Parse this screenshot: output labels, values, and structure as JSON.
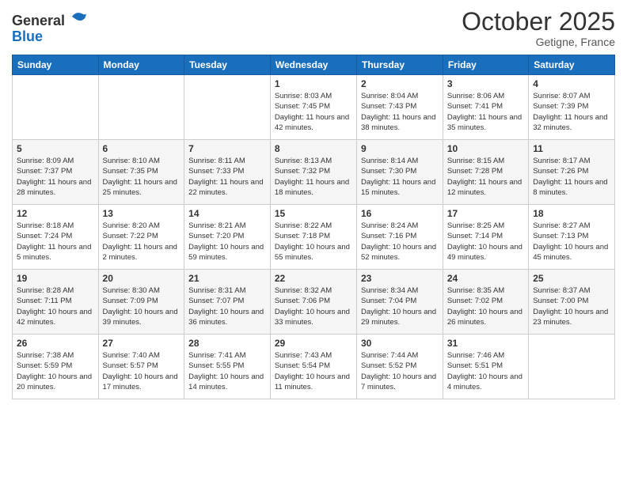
{
  "logo": {
    "line1": "General",
    "line2": "Blue"
  },
  "header": {
    "month": "October 2025",
    "location": "Getigne, France"
  },
  "weekdays": [
    "Sunday",
    "Monday",
    "Tuesday",
    "Wednesday",
    "Thursday",
    "Friday",
    "Saturday"
  ],
  "weeks": [
    [
      {
        "day": "",
        "sunrise": "",
        "sunset": "",
        "daylight": ""
      },
      {
        "day": "",
        "sunrise": "",
        "sunset": "",
        "daylight": ""
      },
      {
        "day": "",
        "sunrise": "",
        "sunset": "",
        "daylight": ""
      },
      {
        "day": "1",
        "sunrise": "Sunrise: 8:03 AM",
        "sunset": "Sunset: 7:45 PM",
        "daylight": "Daylight: 11 hours and 42 minutes."
      },
      {
        "day": "2",
        "sunrise": "Sunrise: 8:04 AM",
        "sunset": "Sunset: 7:43 PM",
        "daylight": "Daylight: 11 hours and 38 minutes."
      },
      {
        "day": "3",
        "sunrise": "Sunrise: 8:06 AM",
        "sunset": "Sunset: 7:41 PM",
        "daylight": "Daylight: 11 hours and 35 minutes."
      },
      {
        "day": "4",
        "sunrise": "Sunrise: 8:07 AM",
        "sunset": "Sunset: 7:39 PM",
        "daylight": "Daylight: 11 hours and 32 minutes."
      }
    ],
    [
      {
        "day": "5",
        "sunrise": "Sunrise: 8:09 AM",
        "sunset": "Sunset: 7:37 PM",
        "daylight": "Daylight: 11 hours and 28 minutes."
      },
      {
        "day": "6",
        "sunrise": "Sunrise: 8:10 AM",
        "sunset": "Sunset: 7:35 PM",
        "daylight": "Daylight: 11 hours and 25 minutes."
      },
      {
        "day": "7",
        "sunrise": "Sunrise: 8:11 AM",
        "sunset": "Sunset: 7:33 PM",
        "daylight": "Daylight: 11 hours and 22 minutes."
      },
      {
        "day": "8",
        "sunrise": "Sunrise: 8:13 AM",
        "sunset": "Sunset: 7:32 PM",
        "daylight": "Daylight: 11 hours and 18 minutes."
      },
      {
        "day": "9",
        "sunrise": "Sunrise: 8:14 AM",
        "sunset": "Sunset: 7:30 PM",
        "daylight": "Daylight: 11 hours and 15 minutes."
      },
      {
        "day": "10",
        "sunrise": "Sunrise: 8:15 AM",
        "sunset": "Sunset: 7:28 PM",
        "daylight": "Daylight: 11 hours and 12 minutes."
      },
      {
        "day": "11",
        "sunrise": "Sunrise: 8:17 AM",
        "sunset": "Sunset: 7:26 PM",
        "daylight": "Daylight: 11 hours and 8 minutes."
      }
    ],
    [
      {
        "day": "12",
        "sunrise": "Sunrise: 8:18 AM",
        "sunset": "Sunset: 7:24 PM",
        "daylight": "Daylight: 11 hours and 5 minutes."
      },
      {
        "day": "13",
        "sunrise": "Sunrise: 8:20 AM",
        "sunset": "Sunset: 7:22 PM",
        "daylight": "Daylight: 11 hours and 2 minutes."
      },
      {
        "day": "14",
        "sunrise": "Sunrise: 8:21 AM",
        "sunset": "Sunset: 7:20 PM",
        "daylight": "Daylight: 10 hours and 59 minutes."
      },
      {
        "day": "15",
        "sunrise": "Sunrise: 8:22 AM",
        "sunset": "Sunset: 7:18 PM",
        "daylight": "Daylight: 10 hours and 55 minutes."
      },
      {
        "day": "16",
        "sunrise": "Sunrise: 8:24 AM",
        "sunset": "Sunset: 7:16 PM",
        "daylight": "Daylight: 10 hours and 52 minutes."
      },
      {
        "day": "17",
        "sunrise": "Sunrise: 8:25 AM",
        "sunset": "Sunset: 7:14 PM",
        "daylight": "Daylight: 10 hours and 49 minutes."
      },
      {
        "day": "18",
        "sunrise": "Sunrise: 8:27 AM",
        "sunset": "Sunset: 7:13 PM",
        "daylight": "Daylight: 10 hours and 45 minutes."
      }
    ],
    [
      {
        "day": "19",
        "sunrise": "Sunrise: 8:28 AM",
        "sunset": "Sunset: 7:11 PM",
        "daylight": "Daylight: 10 hours and 42 minutes."
      },
      {
        "day": "20",
        "sunrise": "Sunrise: 8:30 AM",
        "sunset": "Sunset: 7:09 PM",
        "daylight": "Daylight: 10 hours and 39 minutes."
      },
      {
        "day": "21",
        "sunrise": "Sunrise: 8:31 AM",
        "sunset": "Sunset: 7:07 PM",
        "daylight": "Daylight: 10 hours and 36 minutes."
      },
      {
        "day": "22",
        "sunrise": "Sunrise: 8:32 AM",
        "sunset": "Sunset: 7:06 PM",
        "daylight": "Daylight: 10 hours and 33 minutes."
      },
      {
        "day": "23",
        "sunrise": "Sunrise: 8:34 AM",
        "sunset": "Sunset: 7:04 PM",
        "daylight": "Daylight: 10 hours and 29 minutes."
      },
      {
        "day": "24",
        "sunrise": "Sunrise: 8:35 AM",
        "sunset": "Sunset: 7:02 PM",
        "daylight": "Daylight: 10 hours and 26 minutes."
      },
      {
        "day": "25",
        "sunrise": "Sunrise: 8:37 AM",
        "sunset": "Sunset: 7:00 PM",
        "daylight": "Daylight: 10 hours and 23 minutes."
      }
    ],
    [
      {
        "day": "26",
        "sunrise": "Sunrise: 7:38 AM",
        "sunset": "Sunset: 5:59 PM",
        "daylight": "Daylight: 10 hours and 20 minutes."
      },
      {
        "day": "27",
        "sunrise": "Sunrise: 7:40 AM",
        "sunset": "Sunset: 5:57 PM",
        "daylight": "Daylight: 10 hours and 17 minutes."
      },
      {
        "day": "28",
        "sunrise": "Sunrise: 7:41 AM",
        "sunset": "Sunset: 5:55 PM",
        "daylight": "Daylight: 10 hours and 14 minutes."
      },
      {
        "day": "29",
        "sunrise": "Sunrise: 7:43 AM",
        "sunset": "Sunset: 5:54 PM",
        "daylight": "Daylight: 10 hours and 11 minutes."
      },
      {
        "day": "30",
        "sunrise": "Sunrise: 7:44 AM",
        "sunset": "Sunset: 5:52 PM",
        "daylight": "Daylight: 10 hours and 7 minutes."
      },
      {
        "day": "31",
        "sunrise": "Sunrise: 7:46 AM",
        "sunset": "Sunset: 5:51 PM",
        "daylight": "Daylight: 10 hours and 4 minutes."
      },
      {
        "day": "",
        "sunrise": "",
        "sunset": "",
        "daylight": ""
      }
    ]
  ]
}
